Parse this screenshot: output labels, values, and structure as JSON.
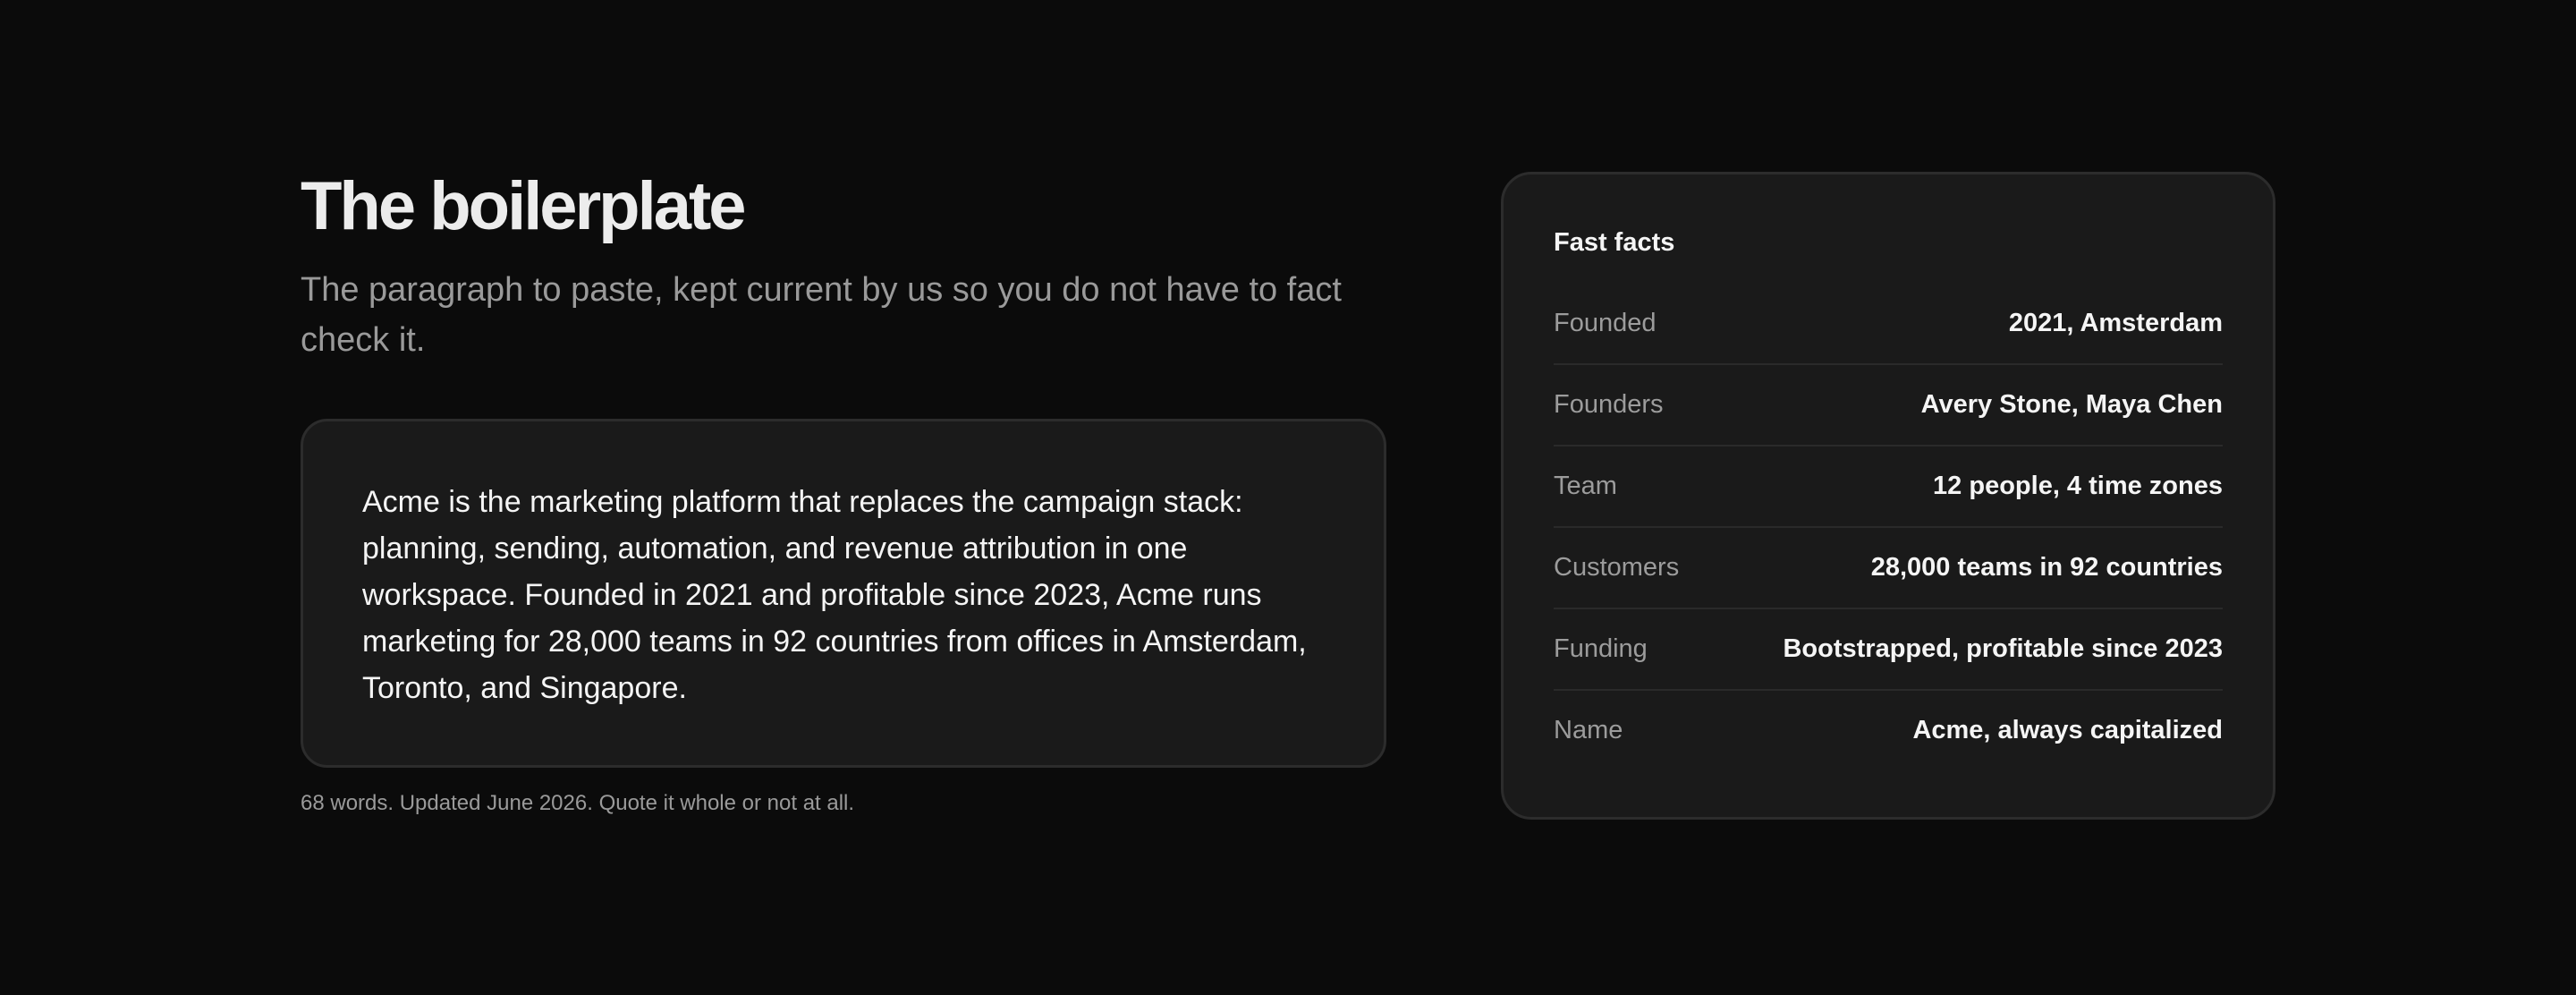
{
  "main": {
    "title": "The boilerplate",
    "subtitle": "The paragraph to paste, kept current by us so you do not have to fact check it.",
    "boilerplate": "Acme is the marketing platform that replaces the campaign stack: planning, sending, automation, and revenue attribution in one workspace. Founded in 2021 and profitable since 2023, Acme runs marketing for 28,000 teams in 92 countries from offices in Amsterdam, Toronto, and Singapore.",
    "note": "68 words. Updated June 2026. Quote it whole or not at all."
  },
  "facts": {
    "heading": "Fast facts",
    "rows": [
      {
        "label": "Founded",
        "value": "2021, Amsterdam"
      },
      {
        "label": "Founders",
        "value": "Avery Stone, Maya Chen"
      },
      {
        "label": "Team",
        "value": "12 people, 4 time zones"
      },
      {
        "label": "Customers",
        "value": "28,000 teams in 92 countries"
      },
      {
        "label": "Funding",
        "value": "Bootstrapped, profitable since 2023"
      },
      {
        "label": "Name",
        "value": "Acme, always capitalized"
      }
    ]
  }
}
